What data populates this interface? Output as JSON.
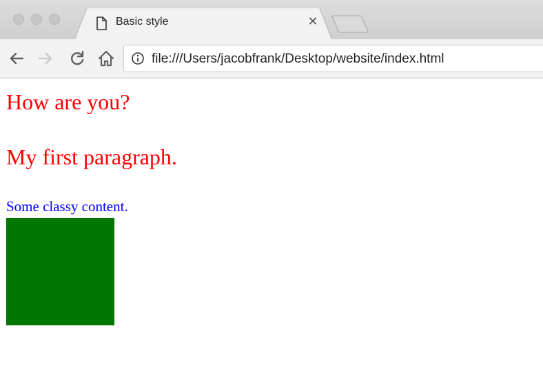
{
  "browser": {
    "tab": {
      "title": "Basic style",
      "close_glyph": "✕",
      "icon": "document-icon"
    },
    "toolbar": {
      "back_icon": "back-arrow-icon",
      "forward_icon": "forward-arrow-icon",
      "reload_icon": "reload-icon",
      "home_icon": "home-icon",
      "info_icon": "info-icon"
    },
    "address_bar": {
      "url": "file:///Users/jacobfrank/Desktop/website/index.html"
    }
  },
  "page": {
    "heading": "How are you?",
    "paragraph": "My first paragraph.",
    "classy_text": "Some classy content.",
    "heading_color": "#ff0000",
    "classy_color": "#0000ff",
    "box_color": "#007500"
  }
}
